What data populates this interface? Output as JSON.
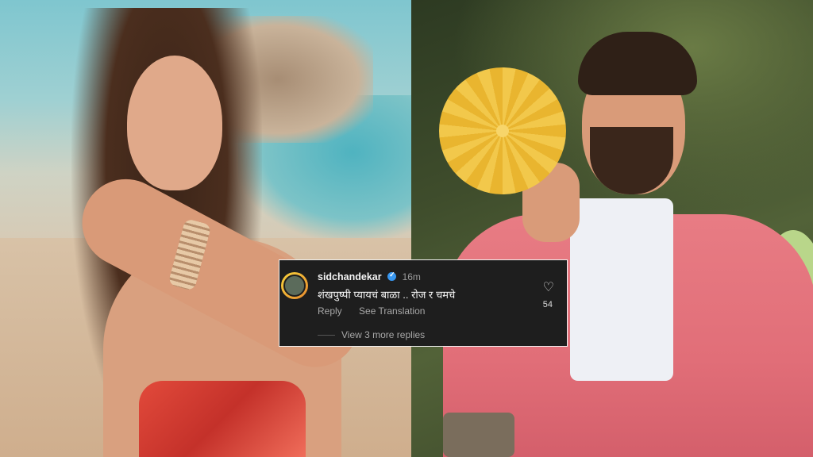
{
  "comment": {
    "username": "sidchandekar",
    "time": "16m",
    "text": "शंखपुष्पी प्यायचं बाळा .. रोज र चमचे",
    "reply_label": "Reply",
    "translate_label": "See Translation",
    "likes": "54",
    "more_replies": "View 3 more replies"
  },
  "icons": {
    "verified": "verified-badge-icon",
    "heart": "heart-icon"
  }
}
